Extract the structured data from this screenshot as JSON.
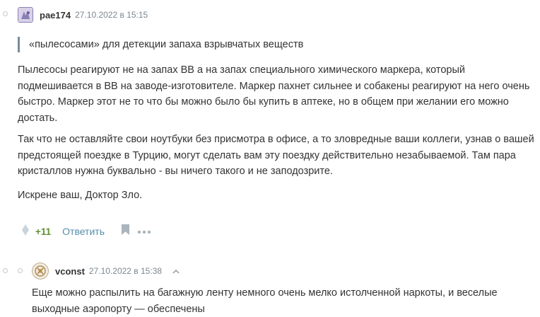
{
  "comment1": {
    "username": "pae174",
    "timestamp": "27.10.2022 в 15:15",
    "quote": "«пылесосами» для детекции запаха взрывчатых веществ",
    "paragraphs": [
      "Пылесосы реагируют не на запах ВВ а на запах специального химического маркера, который подмешивается в ВВ на заводе-изготовителе. Маркер пахнет сильнее и собакены реагируют на него очень быстро. Маркер этот не то что бы можно было бы купить в аптеке, но в общем при желании его можно достать.",
      "Так что не оставляйте свои ноутбуки без присмотра в офисе, а то зловредные ваши коллеги, узнав о вашей предстоящей поездке в Турцию, могут сделать вам эту поездку действительно незабываемой. Там пара кристаллов нужна буквально - вы ничего такого и не заподозрите.",
      "Искрене ваш, Доктор Зло."
    ],
    "votes": "+11",
    "reply_label": "Ответить"
  },
  "comment2": {
    "username": "vconst",
    "timestamp": "27.10.2022 в 15:38",
    "text": "Еще можно распылить на багажную ленту немного очень мелко истолченной наркоты, и веселые выходные аэропорту — обеспечены"
  },
  "colors": {
    "votes_green": "#5e9233",
    "reply_link": "#548eaa",
    "quote_bar": "#7a8c9b",
    "meta_gray": "#7b8790"
  },
  "icons": [
    "thread-dot-icon",
    "vote-diamond-icon",
    "bookmark-icon",
    "more-dots-icon",
    "chevron-up-icon"
  ]
}
